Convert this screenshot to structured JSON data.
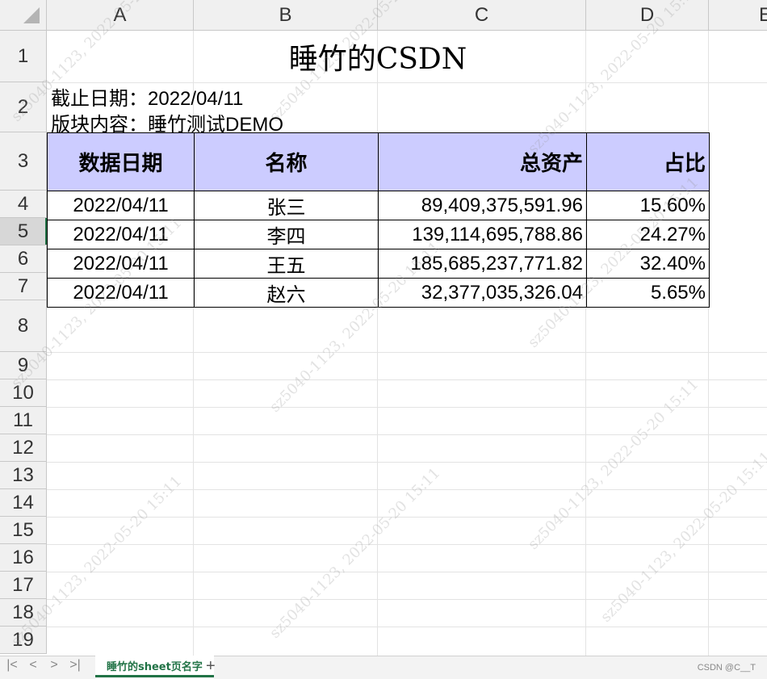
{
  "columns": [
    "A",
    "B",
    "C",
    "D",
    "E"
  ],
  "rows": [
    "1",
    "2",
    "3",
    "4",
    "5",
    "6",
    "7",
    "8",
    "9",
    "10",
    "11",
    "12",
    "13",
    "14",
    "15",
    "16",
    "17",
    "18",
    "19"
  ],
  "title": "睡竹的CSDN",
  "info": {
    "deadline_label": "截止日期：",
    "deadline_value": "2022/04/11",
    "block_label": "版块内容：",
    "block_value": "睡竹测试DEMO"
  },
  "table": {
    "headers": [
      "数据日期",
      "名称",
      "总资产",
      "占比"
    ],
    "rows": [
      [
        "2022/04/11",
        "张三",
        "89,409,375,591.96",
        "15.60%"
      ],
      [
        "2022/04/11",
        "李四",
        "139,114,695,788.86",
        "24.27%"
      ],
      [
        "2022/04/11",
        "王五",
        "185,685,237,771.82",
        "32.40%"
      ],
      [
        "2022/04/11",
        "赵六",
        "32,377,035,326.04",
        "5.65%"
      ]
    ]
  },
  "watermark_text": "sz5040-1123, 2022-05-20 15:11",
  "sheetbar": {
    "nav": [
      "|<",
      "<",
      ">",
      ">|"
    ],
    "sheet_name": "睡竹的sheet页名字",
    "add": "+",
    "credit": "CSDN @C__T"
  },
  "colors": {
    "header_fill": "#ccccff",
    "accent": "#217346"
  }
}
